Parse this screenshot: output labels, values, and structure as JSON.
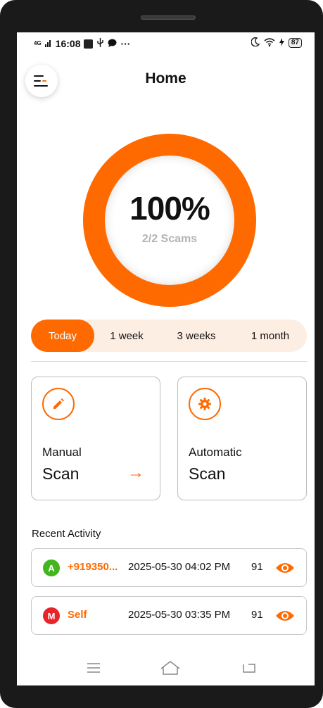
{
  "status_bar": {
    "network": "4G",
    "time": "16:08",
    "more": "···",
    "battery": "87"
  },
  "header": {
    "title": "Home"
  },
  "summary": {
    "percent_text": "100%",
    "percent_value": 100,
    "count_text": "2/2 Scams",
    "ring_color": "#ff6a00"
  },
  "range_tabs": [
    {
      "label": "Today",
      "active": true
    },
    {
      "label": "1 week",
      "active": false
    },
    {
      "label": "3 weeks",
      "active": false
    },
    {
      "label": "1 month",
      "active": false
    }
  ],
  "scan_cards": {
    "manual": {
      "line1": "Manual",
      "line2": "Scan",
      "icon": "pencil-icon",
      "arrow": "→"
    },
    "automatic": {
      "line1": "Automatic",
      "line2": "Scan",
      "icon": "gear-icon"
    }
  },
  "recent": {
    "title": "Recent Activity",
    "items": [
      {
        "initial": "A",
        "badge_color": "#43b51f",
        "who": "+919350...",
        "when": "2025-05-30 04:02 PM",
        "score": "91"
      },
      {
        "initial": "M",
        "badge_color": "#e8232a",
        "who": "Self",
        "when": "2025-05-30 03:35 PM",
        "score": "91"
      }
    ]
  },
  "colors": {
    "accent": "#ff6a00",
    "tab_bg": "#fdeee4"
  }
}
